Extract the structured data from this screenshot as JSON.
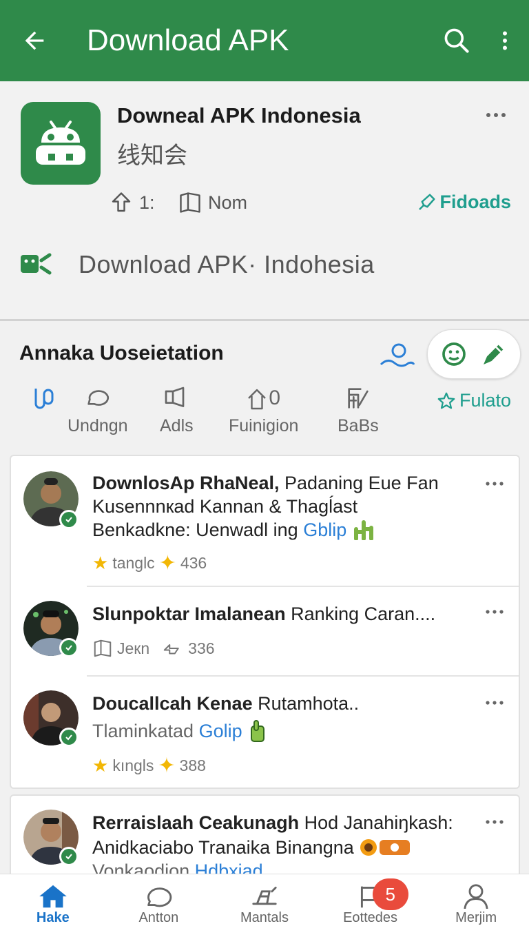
{
  "appbar": {
    "title": "Download APK",
    "back_icon": "arrow-left-icon",
    "search_icon": "search-icon",
    "menu_icon": "more-vert-icon",
    "color": "#2f8a4a"
  },
  "app": {
    "name": "Downeal APK Indonesia",
    "subtitle": "线知会",
    "stat_1": "1:",
    "stat_2": "Nom",
    "action": "Fidoads",
    "download_label": "Download  APK· Indohesia",
    "accent": "#1f9e8e"
  },
  "section": {
    "title": "Annaka Uoseietation",
    "categories": [
      {
        "label": "",
        "icon": "link-icon"
      },
      {
        "label": "Undngn",
        "icon": "chat-bubble-icon"
      },
      {
        "label": "Adls",
        "icon": "megaphone-icon"
      },
      {
        "label": "Fuinigion",
        "icon": "home-count-icon",
        "count": "0"
      },
      {
        "label": "BaBs",
        "icon": "edit-chart-icon"
      }
    ],
    "featured": "Fulato"
  },
  "feed": [
    {
      "line1_bold": "DownlosAp RhaNeal,",
      "line1_rest": " Padaning Eue Fan",
      "line2": "Kusennnкad Kannan & Thagĺast",
      "line3_plain": "Benkadkne: Uenwadl ing ",
      "line3_link": "Gblip",
      "meta_label": "tanglc",
      "meta_count": "436"
    },
    {
      "line1_bold": "Slunpoktar Imalanean",
      "line1_rest": " Ranking Caran....",
      "meta_label": "Jeкn",
      "meta_count": "336"
    },
    {
      "line1_bold": "Doucallcah Kenae",
      "line1_rest": " Rutamhota..",
      "line2_plain": "Tlaminkatad ",
      "line2_link": "Golip",
      "meta_label": "kıngls",
      "meta_count": "388"
    },
    {
      "line1_bold": "Rerraislaah Ceakunagh",
      "line1_rest": " Hod Janahiŋkash:",
      "line2": "Anidkaciabo Tranaika Binangna",
      "line3_plain": "Vonkaodion ",
      "line3_link": "Hdbxiad"
    }
  ],
  "bottom_nav": [
    {
      "label": "Hake",
      "icon": "home-icon",
      "active": true
    },
    {
      "label": "Antton",
      "icon": "chat-icon"
    },
    {
      "label": "Mantals",
      "icon": "tools-icon"
    },
    {
      "label": "Eottedes",
      "icon": "flag-icon",
      "badge": "5"
    },
    {
      "label": "Merjim",
      "icon": "person-icon"
    }
  ]
}
